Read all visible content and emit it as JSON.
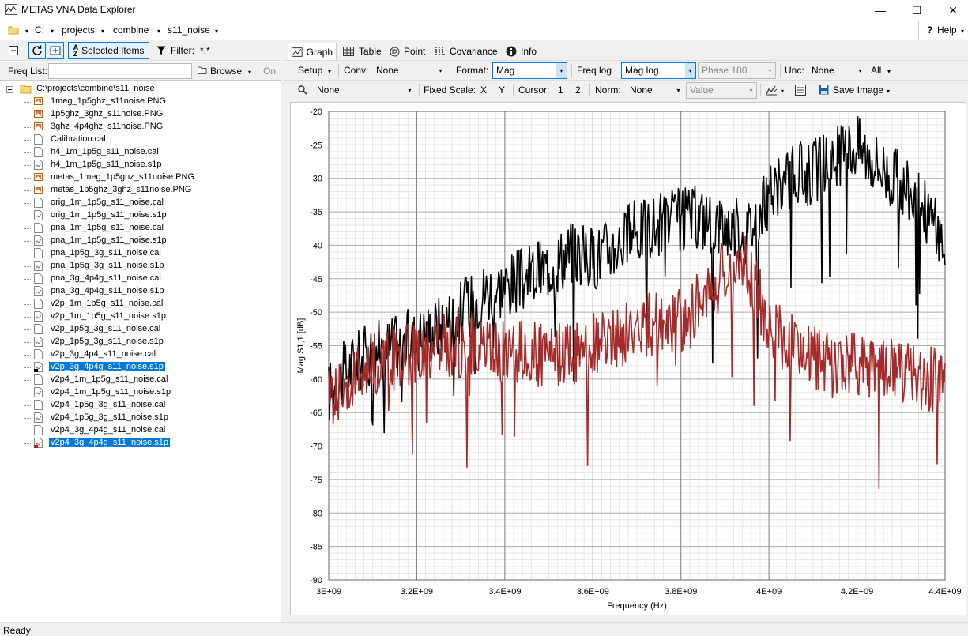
{
  "window": {
    "title": "METAS VNA Data Explorer",
    "minimize": "—",
    "maximize": "☐",
    "close": "✕"
  },
  "address": {
    "drive": "C:",
    "p1": "projects",
    "p2": "combine",
    "p3": "s11_noise",
    "help": "Help"
  },
  "left_toolbar": {
    "selected_items": "Selected Items",
    "filter_label": "Filter:",
    "filter_value": "*.*"
  },
  "freq_list": {
    "label": "Freq List:",
    "browse": "Browse",
    "on": "On"
  },
  "tree": {
    "root": "C:\\projects\\combine\\s11_noise",
    "items": [
      {
        "name": "1meg_1p5ghz_s11noise.PNG",
        "type": "png",
        "selected": false
      },
      {
        "name": "1p5ghz_3ghz_s11noise.PNG",
        "type": "png",
        "selected": false
      },
      {
        "name": "3ghz_4p4ghz_s11noise.PNG",
        "type": "png",
        "selected": false
      },
      {
        "name": "Calibration.cal",
        "type": "cal",
        "selected": false
      },
      {
        "name": "h4_1m_1p5g_s11_noise.cal",
        "type": "cal",
        "selected": false
      },
      {
        "name": "h4_1m_1p5g_s11_noise.s1p",
        "type": "s1p",
        "selected": false
      },
      {
        "name": "metas_1meg_1p5ghz_s11noise.PNG",
        "type": "png",
        "selected": false
      },
      {
        "name": "metas_1p5ghz_3ghz_s11noise.PNG",
        "type": "png",
        "selected": false
      },
      {
        "name": "orig_1m_1p5g_s11_noise.cal",
        "type": "cal",
        "selected": false
      },
      {
        "name": "orig_1m_1p5g_s11_noise.s1p",
        "type": "s1p",
        "selected": false
      },
      {
        "name": "pna_1m_1p5g_s11_noise.cal",
        "type": "cal",
        "selected": false
      },
      {
        "name": "pna_1m_1p5g_s11_noise.s1p",
        "type": "s1p",
        "selected": false
      },
      {
        "name": "pna_1p5g_3g_s11_noise.cal",
        "type": "cal",
        "selected": false
      },
      {
        "name": "pna_1p5g_3g_s11_noise.s1p",
        "type": "s1p",
        "selected": false
      },
      {
        "name": "pna_3g_4p4g_s11_noise.cal",
        "type": "cal",
        "selected": false
      },
      {
        "name": "pna_3g_4p4g_s11_noise.s1p",
        "type": "s1p",
        "selected": false
      },
      {
        "name": "v2p_1m_1p5g_s11_noise.cal",
        "type": "cal",
        "selected": false
      },
      {
        "name": "v2p_1m_1p5g_s11_noise.s1p",
        "type": "s1p",
        "selected": false
      },
      {
        "name": "v2p_1p5g_3g_s11_noise.cal",
        "type": "cal",
        "selected": false
      },
      {
        "name": "v2p_1p5g_3g_s11_noise.s1p",
        "type": "s1p",
        "selected": false
      },
      {
        "name": "v2p_3g_4p4_s11_noise.cal",
        "type": "cal",
        "selected": false
      },
      {
        "name": "v2p_3g_4p4g_s11_noise.s1p",
        "type": "s1p",
        "selected": true,
        "marker": "#000000"
      },
      {
        "name": "v2p4_1m_1p5g_s11_noise.cal",
        "type": "cal",
        "selected": false
      },
      {
        "name": "v2p4_1m_1p5g_s11_noise.s1p",
        "type": "s1p",
        "selected": false
      },
      {
        "name": "v2p4_1p5g_3g_s11_noise.cal",
        "type": "cal",
        "selected": false
      },
      {
        "name": "v2p4_1p5g_3g_s11_noise.s1p",
        "type": "s1p",
        "selected": false
      },
      {
        "name": "v2p4_3g_4p4g_s11_noise.cal",
        "type": "cal",
        "selected": false
      },
      {
        "name": "v2p4_3g_4p4g_s11_noise.s1p",
        "type": "s1p",
        "selected": true,
        "marker": "#b22222"
      }
    ]
  },
  "tabs": [
    "Graph",
    "Table",
    "Point",
    "Covariance",
    "Info"
  ],
  "toolbar1": {
    "setup": "Setup",
    "conv_label": "Conv:",
    "conv_value": "None",
    "format_label": "Format:",
    "format_value": "Mag",
    "freq_log": "Freq log",
    "mag_log": "Mag log",
    "phase": "Phase 180",
    "unc_label": "Unc:",
    "unc_value": "None",
    "all": "All"
  },
  "toolbar2": {
    "zoom_value": "None",
    "fixed_scale": "Fixed Scale:",
    "x": "X",
    "y": "Y",
    "cursor_label": "Cursor:",
    "c1": "1",
    "c2": "2",
    "norm_label": "Norm:",
    "norm_value": "None",
    "value_placeholder": "Value",
    "save_image": "Save Image"
  },
  "status": "Ready",
  "colors": {
    "selection": "#0078d7",
    "trace1": "#000000",
    "trace2": "#a52a2a"
  },
  "chart_data": {
    "type": "line",
    "xlabel": "Frequency (Hz)",
    "ylabel": "Mag S1,1 [dB]",
    "xlim": [
      3000000000,
      4400000000
    ],
    "ylim": [
      -90,
      -20
    ],
    "xticks": [
      "3E+09",
      "3.2E+09",
      "3.4E+09",
      "3.6E+09",
      "3.8E+09",
      "4E+09",
      "4.2E+09",
      "4.4E+09"
    ],
    "yticks": [
      "-20",
      "-25",
      "-30",
      "-35",
      "-40",
      "-45",
      "-50",
      "-55",
      "-60",
      "-65",
      "-70",
      "-75",
      "-80",
      "-85",
      "-90"
    ],
    "grid": true,
    "series": [
      {
        "color": "#000000",
        "x": [
          3000000000.0,
          3050000000.0,
          3100000000.0,
          3150000000.0,
          3200000000.0,
          3250000000.0,
          3300000000.0,
          3350000000.0,
          3400000000.0,
          3450000000.0,
          3500000000.0,
          3550000000.0,
          3600000000.0,
          3650000000.0,
          3700000000.0,
          3750000000.0,
          3800000000.0,
          3850000000.0,
          3900000000.0,
          3950000000.0,
          4000000000.0,
          4050000000.0,
          4100000000.0,
          4150000000.0,
          4200000000.0,
          4250000000.0,
          4300000000.0,
          4350000000.0,
          4400000000.0
        ],
        "y": [
          -62,
          -58,
          -56,
          -55,
          -54,
          -52,
          -50,
          -47,
          -46,
          -45,
          -43,
          -41,
          -42,
          -40,
          -38,
          -37,
          -36,
          -36,
          -37,
          -38,
          -33,
          -30,
          -29,
          -27,
          -25,
          -28,
          -31,
          -34,
          -40
        ]
      },
      {
        "color": "#a52a2a",
        "x": [
          3000000000.0,
          3050000000.0,
          3100000000.0,
          3150000000.0,
          3200000000.0,
          3250000000.0,
          3300000000.0,
          3350000000.0,
          3400000000.0,
          3450000000.0,
          3500000000.0,
          3550000000.0,
          3600000000.0,
          3650000000.0,
          3700000000.0,
          3750000000.0,
          3800000000.0,
          3850000000.0,
          3900000000.0,
          3950000000.0,
          4000000000.0,
          4050000000.0,
          4100000000.0,
          4150000000.0,
          4200000000.0,
          4250000000.0,
          4300000000.0,
          4350000000.0,
          4400000000.0
        ],
        "y": [
          -63,
          -60,
          -58,
          -57,
          -56,
          -55,
          -55,
          -55,
          -56,
          -56,
          -57,
          -56,
          -55,
          -54,
          -52,
          -52,
          -51,
          -48,
          -44,
          -43,
          -52,
          -55,
          -57,
          -58,
          -58,
          -58,
          -59,
          -60,
          -60
        ]
      }
    ]
  }
}
